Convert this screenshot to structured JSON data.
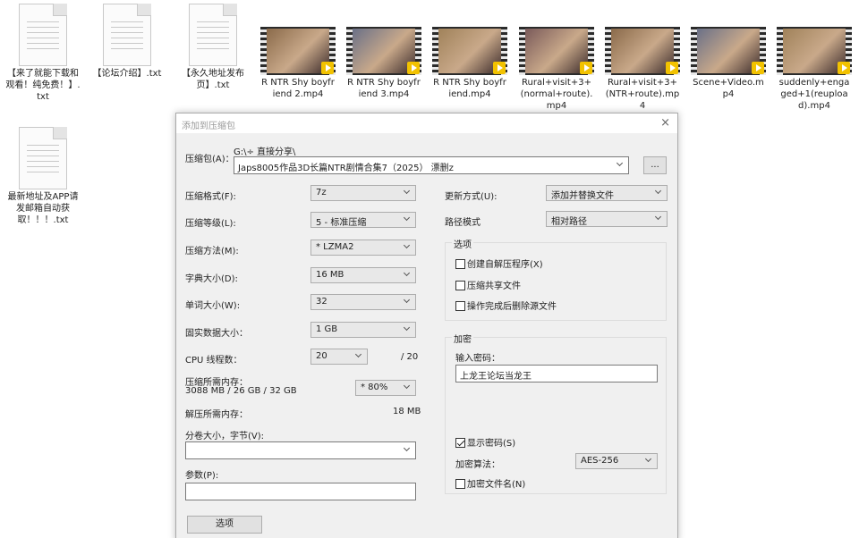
{
  "desktop": {
    "files_row1": [
      {
        "name": "【来了就能下载和观看！纯免费！】.txt",
        "type": "txt"
      },
      {
        "name": "【论坛介绍】.txt",
        "type": "txt"
      },
      {
        "name": "【永久地址发布页】.txt",
        "type": "txt"
      },
      {
        "name": "R NTR Shy boyfriend 2.mp4",
        "type": "video"
      },
      {
        "name": "R NTR Shy boyfriend 3.mp4",
        "type": "video"
      },
      {
        "name": "R NTR Shy boyfriend.mp4",
        "type": "video"
      },
      {
        "name": "Rural+visit+3+(normal+route).mp4",
        "type": "video"
      },
      {
        "name": "Rural+visit+3+(NTR+route).mp4",
        "type": "video"
      },
      {
        "name": "Scene+Video.mp4",
        "type": "video"
      },
      {
        "name": "suddenly+engaged+1(reupload).mp4",
        "type": "video"
      }
    ],
    "files_row2": [
      {
        "name": "最新地址及APP请发邮箱自动获取！！！.txt",
        "type": "txt"
      }
    ]
  },
  "dialog": {
    "title": "添加到压缩包",
    "close_icon": "×",
    "archive_label": "压缩包(A)：",
    "archive_path": "G:\\÷ 直接分享\\",
    "archive_name": "Japs8005作品3D长篇NTR剧情合集7（2025） 漂删z",
    "browse_label": "...",
    "format_label": "压缩格式(F):",
    "format_value": "7z",
    "level_label": "压缩等级(L):",
    "level_value": "5 - 标准压缩",
    "method_label": "压缩方法(M):",
    "method_value": "* LZMA2",
    "dict_label": "字典大小(D):",
    "dict_value": "16 MB",
    "word_label": "单词大小(W):",
    "word_value": "32",
    "solid_label": "固实数据大小：",
    "solid_value": "1 GB",
    "threads_label": "CPU 线程数：",
    "threads_value": "20",
    "threads_max": "/ 20",
    "mem_comp_label": "压缩所需内存：",
    "mem_comp_value": "3088 MB / 26 GB / 32 GB",
    "mem_pct_value": "* 80%",
    "mem_decomp_label": "解压所需内存：",
    "mem_decomp_value": "18 MB",
    "split_label": "分卷大小，字节(V):",
    "split_value": "",
    "params_label": "参数(P):",
    "params_value": "",
    "options_button": "选项",
    "update_label": "更新方式(U):",
    "update_value": "添加并替换文件",
    "path_label": "路径模式",
    "path_value": "相对路径",
    "options_group": "选项",
    "opt_sfx": "创建自解压程序(X)",
    "opt_shared": "压缩共享文件",
    "opt_delete": "操作完成后删除源文件",
    "encrypt_group": "加密",
    "password_label": "输入密码：",
    "password_value": "上龙王论坛当龙王",
    "show_pwd": "显示密码(S)",
    "enc_method_label": "加密算法：",
    "enc_method_value": "AES-256",
    "enc_names": "加密文件名(N)"
  }
}
